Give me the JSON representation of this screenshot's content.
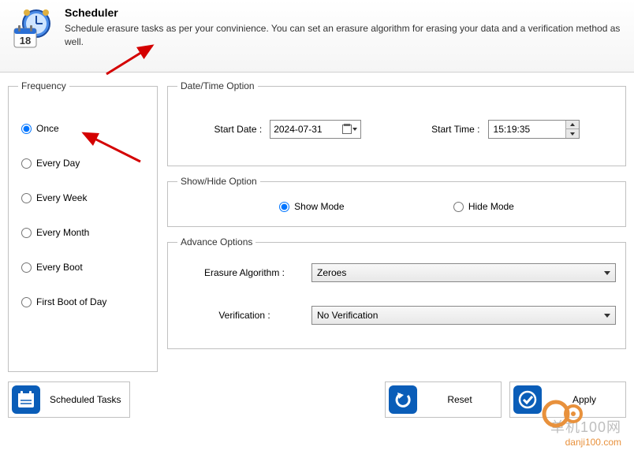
{
  "header": {
    "title": "Scheduler",
    "description": "Schedule erasure tasks as per your convinience. You can set an erasure algorithm for erasing your data and a verification method as well."
  },
  "frequency": {
    "legend": "Frequency",
    "options": [
      {
        "label": "Once",
        "checked": true
      },
      {
        "label": "Every Day",
        "checked": false
      },
      {
        "label": "Every Week",
        "checked": false
      },
      {
        "label": "Every Month",
        "checked": false
      },
      {
        "label": "Every Boot",
        "checked": false
      },
      {
        "label": "First Boot of Day",
        "checked": false
      }
    ]
  },
  "datetime": {
    "legend": "Date/Time Option",
    "start_date_label": "Start Date :",
    "start_date_value": "2024-07-31",
    "start_time_label": "Start Time :",
    "start_time_value": "15:19:35"
  },
  "showhide": {
    "legend": "Show/Hide Option",
    "show_label": "Show Mode",
    "hide_label": "Hide Mode",
    "selected": "show"
  },
  "advance": {
    "legend": "Advance Options",
    "erasure_label": "Erasure Algorithm :",
    "erasure_value": "Zeroes",
    "verification_label": "Verification :",
    "verification_value": "No Verification"
  },
  "footer": {
    "scheduled_tasks": "Scheduled Tasks",
    "reset": "Reset",
    "apply": "Apply"
  },
  "watermark": {
    "line1": "单机100网",
    "line2": "danji100.com"
  },
  "icon_day": "18"
}
